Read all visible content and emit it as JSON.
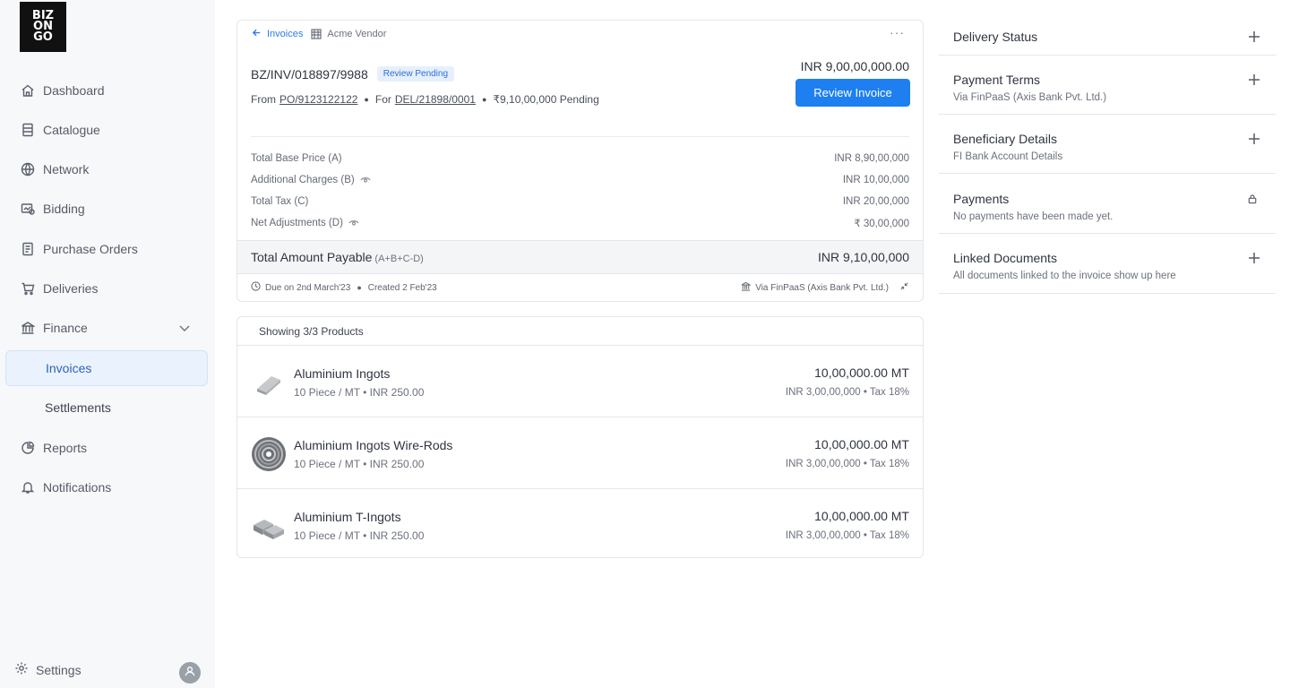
{
  "brand": {
    "logo_line1": "BIZ",
    "logo_line2": "ON",
    "logo_line3": "GO"
  },
  "sidebar": {
    "items": [
      {
        "label": "Dashboard",
        "icon": "home-icon"
      },
      {
        "label": "Catalogue",
        "icon": "catalogue-icon"
      },
      {
        "label": "Network",
        "icon": "globe-icon"
      },
      {
        "label": "Bidding",
        "icon": "bidding-icon"
      },
      {
        "label": "Purchase Orders",
        "icon": "document-icon"
      },
      {
        "label": "Deliveries",
        "icon": "cart-icon"
      },
      {
        "label": "Finance",
        "icon": "bank-icon"
      },
      {
        "label": "Invoices"
      },
      {
        "label": "Settlements"
      },
      {
        "label": "Reports",
        "icon": "pie-chart-icon"
      },
      {
        "label": "Notifications",
        "icon": "bell-icon"
      }
    ],
    "settings_label": "Settings"
  },
  "invoice": {
    "breadcrumb_back": "Invoices",
    "vendor": "Acme Vendor",
    "number": "BZ/INV/018897/9988",
    "status_badge": "Review Pending",
    "from_label": "From",
    "po_number": "PO/9123122122",
    "for_label": "For",
    "delivery_number": "DEL/21898/0001",
    "pending_text": "₹9,10,00,000 Pending",
    "amount": "INR 9,00,00,000.00",
    "review_button": "Review Invoice",
    "breakdown": [
      {
        "label": "Total Base Price (A)",
        "value": "INR 8,90,00,000",
        "eye": false
      },
      {
        "label": "Additional Charges (B)",
        "value": "INR 10,00,000",
        "eye": true
      },
      {
        "label": "Total Tax (C)",
        "value": "INR 20,00,000",
        "eye": false
      },
      {
        "label": "Net Adjustments (D)",
        "value": "₹ 30,00,000",
        "eye": true
      }
    ],
    "total_label": "Total Amount Payable",
    "total_formula": "(A+B+C-D)",
    "total_value": "INR 9,10,00,000",
    "due_text": "Due on 2nd March'23",
    "created_text": "Created 2 Feb'23",
    "via_text": "Via FinPaaS (Axis Bank Pvt. Ltd.)"
  },
  "products": {
    "heading": "Showing 3/3 Products",
    "items": [
      {
        "name": "Aluminium Ingots",
        "meta": "10 Piece / MT • INR 250.00",
        "qty": "10,00,000.00 MT",
        "price": "INR 3,00,00,000 • Tax 18%"
      },
      {
        "name": "Aluminium Ingots Wire-Rods",
        "meta": "10 Piece / MT • INR 250.00",
        "qty": "10,00,000.00 MT",
        "price": "INR 3,00,00,000 • Tax 18%"
      },
      {
        "name": "Aluminium T-Ingots",
        "meta": "10 Piece / MT • INR 250.00",
        "qty": "10,00,000.00 MT",
        "price": "INR 3,00,00,000 • Tax 18%"
      }
    ]
  },
  "right_panel": {
    "sections": [
      {
        "title": "Delivery Status",
        "subtitle": "",
        "action": "plus-icon"
      },
      {
        "title": "Payment Terms",
        "subtitle": "Via FinPaaS (Axis Bank Pvt. Ltd.)",
        "action": "plus-icon"
      },
      {
        "title": "Beneficiary Details",
        "subtitle": "FI Bank Account Details",
        "action": "plus-icon"
      },
      {
        "title": "Payments",
        "subtitle": "No payments have been made yet.",
        "action": "lock-icon"
      },
      {
        "title": "Linked Documents",
        "subtitle": "All documents linked to the invoice show up here",
        "action": "plus-icon"
      }
    ]
  },
  "colors": {
    "accent": "#1e7ff0",
    "badge_bg": "#e6f0fd",
    "sidebar_bg": "#f7f8fa",
    "active_bg": "#eaf2fd"
  }
}
